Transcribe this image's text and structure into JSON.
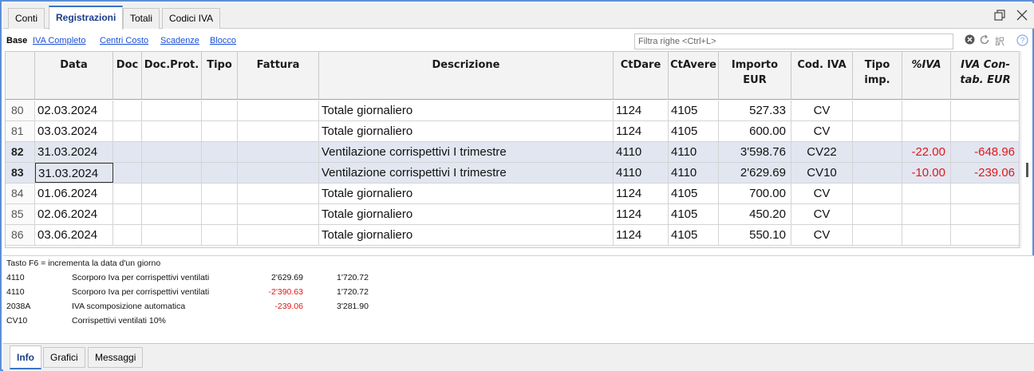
{
  "tabs": [
    "Conti",
    "Registrazioni",
    "Totali",
    "Codici IVA"
  ],
  "active_tab": "Registrazioni",
  "views": {
    "base": "Base",
    "links": [
      "IVA Completo",
      "Centri Costo",
      "Scadenze",
      "Blocco"
    ]
  },
  "filter": {
    "placeholder": "Filtra righe <Ctrl+L>"
  },
  "columns": [
    "Data",
    "Doc",
    "Doc.Prot.",
    "Tipo",
    "Fattura",
    "Descrizione",
    "CtDare",
    "CtAvere",
    "Importo EUR",
    "Cod. IVA",
    "Tipo imp.",
    "%IVA",
    "IVA Contab. EUR"
  ],
  "header_lines": {
    "importo": [
      "Importo",
      "EUR"
    ],
    "tipo_imp": [
      "Tipo",
      "imp."
    ],
    "iva_contab": [
      "IVA Con-",
      "tab. EUR"
    ]
  },
  "rows": [
    {
      "n": "80",
      "data": "02.03.2024",
      "descrizione": "Totale giornaliero",
      "ctdare": "1124",
      "ctavere": "4105",
      "importo": "527.33",
      "codiva": "CV",
      "piva": "",
      "ivacontab": "",
      "selected": false
    },
    {
      "n": "81",
      "data": "03.03.2024",
      "descrizione": "Totale giornaliero",
      "ctdare": "1124",
      "ctavere": "4105",
      "importo": "600.00",
      "codiva": "CV",
      "piva": "",
      "ivacontab": "",
      "selected": false
    },
    {
      "n": "82",
      "data": "31.03.2024",
      "descrizione": "Ventilazione corrispettivi I trimestre",
      "ctdare": "4110",
      "ctavere": "4110",
      "importo": "3'598.76",
      "codiva": "CV22",
      "piva": "-22.00",
      "ivacontab": "-648.96",
      "selected": true
    },
    {
      "n": "83",
      "data": "31.03.2024",
      "descrizione": "Ventilazione corrispettivi I trimestre",
      "ctdare": "4110",
      "ctavere": "4110",
      "importo": "2'629.69",
      "codiva": "CV10",
      "piva": "-10.00",
      "ivacontab": "-239.06",
      "selected": true
    },
    {
      "n": "84",
      "data": "01.06.2024",
      "descrizione": "Totale giornaliero",
      "ctdare": "1124",
      "ctavere": "4105",
      "importo": "700.00",
      "codiva": "CV",
      "piva": "",
      "ivacontab": "",
      "selected": false
    },
    {
      "n": "85",
      "data": "02.06.2024",
      "descrizione": "Totale giornaliero",
      "ctdare": "1124",
      "ctavere": "4105",
      "importo": "450.20",
      "codiva": "CV",
      "piva": "",
      "ivacontab": "",
      "selected": false
    },
    {
      "n": "86",
      "data": "03.06.2024",
      "descrizione": "Totale giornaliero",
      "ctdare": "1124",
      "ctavere": "4105",
      "importo": "550.10",
      "codiva": "CV",
      "piva": "",
      "ivacontab": "",
      "selected": false
    }
  ],
  "info": {
    "hint": "Tasto F6 = incrementa la data d'un giorno",
    "lines": [
      {
        "account": "4110",
        "description": "Scorporo Iva per corrispettivi ventilati",
        "amount": "2'629.69",
        "balance": "1'720.72",
        "negative": false
      },
      {
        "account": "4110",
        "description": "Scorporo Iva per corrispettivi ventilati",
        "amount": "-2'390.63",
        "balance": "1'720.72",
        "negative": true
      },
      {
        "account": "2038A",
        "description": "IVA scomposizione automatica",
        "amount": "-239.06",
        "balance": "3'281.90",
        "negative": true
      },
      {
        "account": "CV10",
        "description": "Corrispettivi ventilati 10%",
        "amount": "",
        "balance": "",
        "negative": false
      }
    ]
  },
  "bottom_tabs": [
    "Info",
    "Grafici",
    "Messaggi"
  ],
  "colors": {
    "accent": "#3a73c9",
    "negative": "#e01818",
    "selected_row": "#e2e6f1",
    "link": "#1b4fd6"
  },
  "icons": [
    "restore-window-icon",
    "close-icon",
    "clear-filter-icon",
    "refresh-icon",
    "translate-icon",
    "help-icon"
  ]
}
